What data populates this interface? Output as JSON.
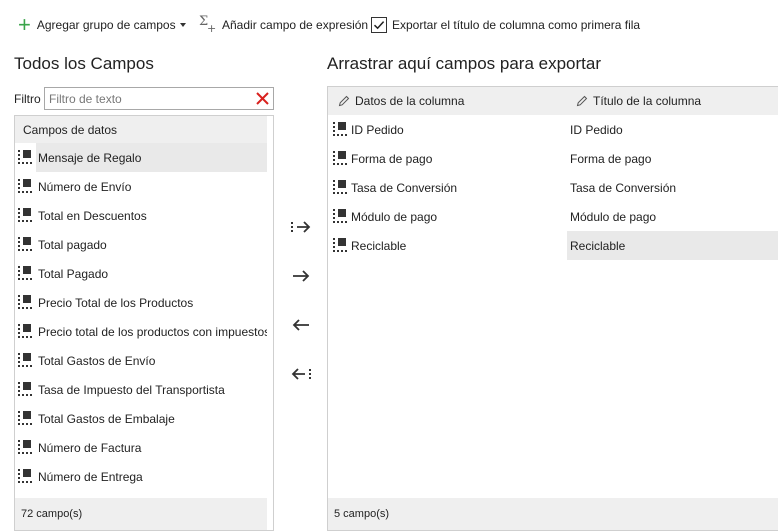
{
  "toolbar": {
    "add_group_label": "Agregar grupo de campos",
    "add_expression_label": "Añadir campo de expresión",
    "export_title_label": "Exportar el título de columna como primera fila",
    "export_title_checked": true
  },
  "left": {
    "title": "Todos los Campos",
    "filter_label": "Filtro",
    "filter_placeholder": "Filtro de texto",
    "list_header": "Campos de datos",
    "items": [
      {
        "label": "Mensaje de Regalo",
        "selected": true
      },
      {
        "label": "Número de Envío"
      },
      {
        "label": "Total en Descuentos"
      },
      {
        "label": "Total pagado"
      },
      {
        "label": "Total Pagado"
      },
      {
        "label": "Precio Total de los Productos"
      },
      {
        "label": "Precio total de los productos con impuestos"
      },
      {
        "label": "Total Gastos de Envío"
      },
      {
        "label": "Tasa de Impuesto del Transportista"
      },
      {
        "label": "Total Gastos de Embalaje"
      },
      {
        "label": "Número de Factura"
      },
      {
        "label": "Número de Entrega"
      }
    ],
    "footer": "72 campo(s)"
  },
  "right": {
    "title": "Arrastrar aquí campos para exportar",
    "col_data_header": "Datos de la columna",
    "col_title_header": "Título de la columna",
    "rows": [
      {
        "data": "ID Pedido",
        "title": "ID Pedido"
      },
      {
        "data": "Forma de pago",
        "title": "Forma de pago"
      },
      {
        "data": "Tasa de Conversión",
        "title": "Tasa de Conversión"
      },
      {
        "data": "Módulo de pago",
        "title": "Módulo de pago"
      },
      {
        "data": "Reciclable",
        "title": "Reciclable",
        "selected": true
      }
    ],
    "footer": "5 campo(s)"
  },
  "colors": {
    "accent_green": "#3aa44a",
    "clear_red": "#d9211e",
    "panel_header_bg": "#efefef",
    "selected_bg": "#e9e9e9"
  },
  "icons": [
    "plus-icon",
    "sigma-plus-icon",
    "checkbox-icon",
    "clear-icon",
    "pencil-icon",
    "drag-handle-icon",
    "move-all-right-icon",
    "move-right-icon",
    "move-left-icon",
    "move-all-left-icon"
  ]
}
